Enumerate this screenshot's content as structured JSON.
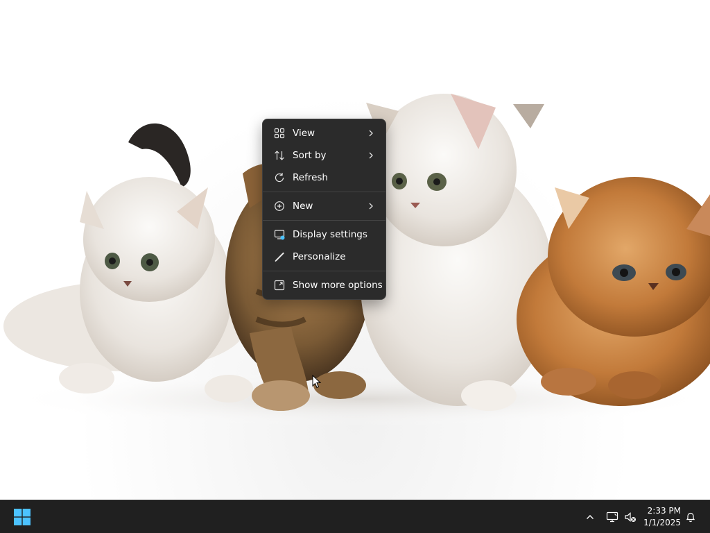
{
  "desktop": {
    "wallpaper": "kittens"
  },
  "context_menu": {
    "items": [
      {
        "label": "View",
        "icon": "grid-icon",
        "submenu": true
      },
      {
        "label": "Sort by",
        "icon": "sort-icon",
        "submenu": true
      },
      {
        "label": "Refresh",
        "icon": "refresh-icon",
        "submenu": false
      },
      {
        "label": "New",
        "icon": "plus-circle-icon",
        "submenu": true
      },
      {
        "label": "Display settings",
        "icon": "display-icon",
        "submenu": false
      },
      {
        "label": "Personalize",
        "icon": "brush-icon",
        "submenu": false
      },
      {
        "label": "Show more options",
        "icon": "expand-icon",
        "submenu": false
      }
    ]
  },
  "taskbar": {
    "start_icon": "windows-logo-icon",
    "tray_icons": [
      "chevron-up-icon",
      "network-icon",
      "volume-muted-icon",
      "bell-icon"
    ],
    "clock": {
      "time": "2:33 PM",
      "date": "1/1/2025"
    }
  },
  "colors": {
    "menu_bg": "#2b2b2b",
    "taskbar_bg": "#202020",
    "accent": "#4cc2ff"
  }
}
